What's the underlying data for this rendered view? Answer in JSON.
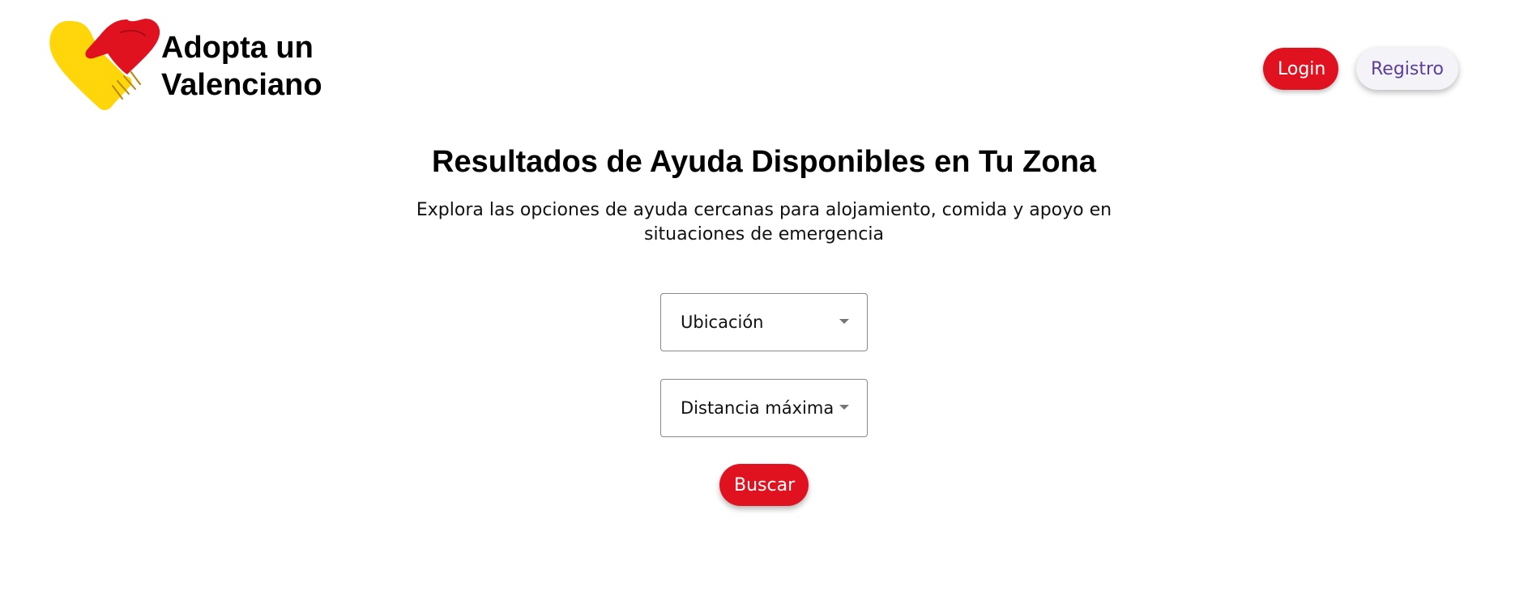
{
  "brand": {
    "name_line1": "Adopta un",
    "name_line2": "Valenciano",
    "logo_icon": "heart-handshake-icon",
    "colors": {
      "red": "#e1121f",
      "yellow": "#ffd60a"
    }
  },
  "nav": {
    "login_label": "Login",
    "register_label": "Registro"
  },
  "main": {
    "title": "Resultados de Ayuda Disponibles en Tu Zona",
    "subtitle": "Explora las opciones de ayuda cercanas para alojamiento, comida y apoyo en situaciones de emergencia",
    "location_select": {
      "label": "Ubicación",
      "icon": "chevron-down-icon"
    },
    "distance_select": {
      "label": "Distancia máxima",
      "icon": "chevron-down-icon"
    },
    "search_label": "Buscar"
  },
  "theme": {
    "accent": "#e1121f",
    "register_text": "#5b3f97",
    "register_bg": "#f4f3f8"
  }
}
